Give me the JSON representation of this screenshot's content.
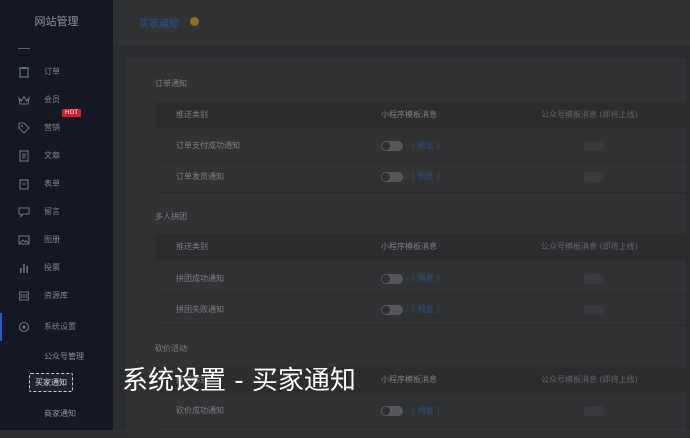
{
  "sidebar": {
    "title": "网站管理",
    "items": [
      {
        "label": "订单",
        "icon": "clipboard-icon"
      },
      {
        "label": "会员",
        "icon": "crown-icon"
      },
      {
        "label": "营销",
        "icon": "tag-icon",
        "badge": "HOT"
      },
      {
        "label": "文章",
        "icon": "document-icon"
      },
      {
        "label": "表单",
        "icon": "form-icon"
      },
      {
        "label": "留言",
        "icon": "message-icon"
      },
      {
        "label": "图册",
        "icon": "image-icon"
      },
      {
        "label": "投票",
        "icon": "bar-chart-icon"
      },
      {
        "label": "资源库",
        "icon": "database-icon"
      },
      {
        "label": "系统设置",
        "icon": "settings-icon"
      }
    ],
    "subitems": [
      "公众号管理",
      "买家通知",
      "商家通知"
    ]
  },
  "header": {
    "breadcrumb": "买家通知",
    "icon": "coin-icon"
  },
  "columns": {
    "type": "推送类别",
    "mini": "小程序模板消息",
    "mp": "公众号模板消息 (即将上线)"
  },
  "preview_label": "[ 预览 ]",
  "sections": [
    {
      "title": "订单通知",
      "rows": [
        "订单支付成功通知",
        "订单发货通知"
      ]
    },
    {
      "title": "多人拼团",
      "rows": [
        "拼团成功通知",
        "拼团失败通知"
      ]
    },
    {
      "title": "砍价活动",
      "rows": [
        "砍价成功通知"
      ]
    }
  ],
  "caption": "系统设置 - 买家通知",
  "colors": {
    "accent": "#2f5bb8",
    "hot": "#c8262c"
  }
}
